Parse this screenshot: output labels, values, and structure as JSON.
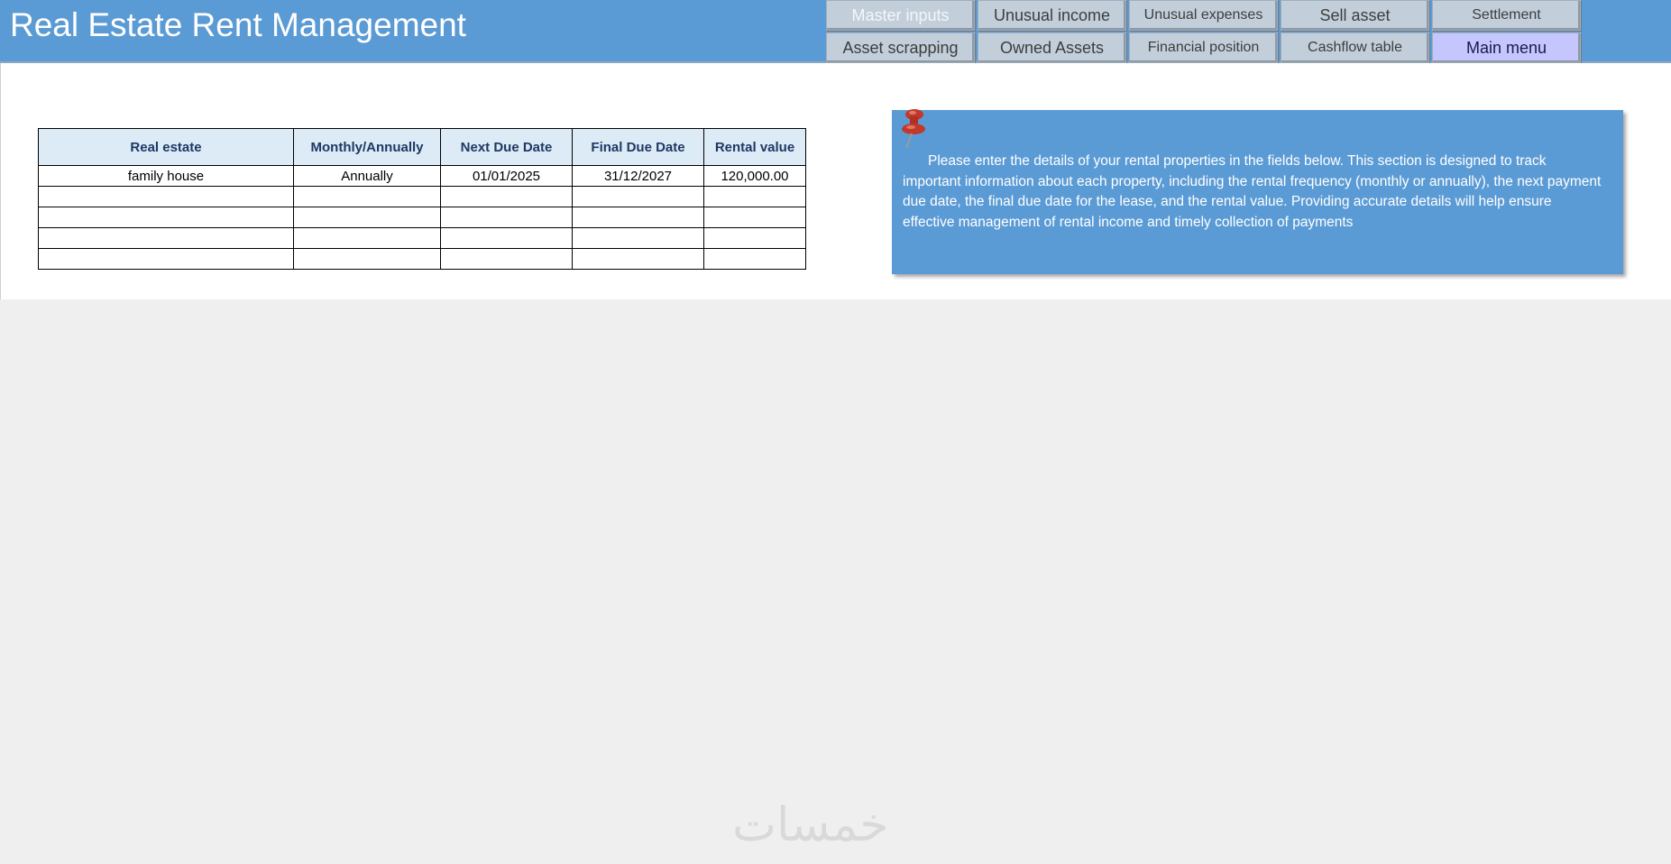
{
  "header": {
    "title": "Real Estate Rent Management"
  },
  "nav": {
    "row1": [
      "Master inputs",
      "Unusual income",
      "Unusual expenses",
      "Sell asset",
      "Settlement"
    ],
    "row2": [
      "Asset scrapping",
      "Owned Assets",
      "Financial position",
      "Cashflow table",
      "Main menu"
    ]
  },
  "table": {
    "headers": [
      "Real estate",
      "Monthly/Annually",
      "Next Due Date",
      "Final Due Date",
      "Rental value"
    ],
    "rows": [
      [
        "family house",
        "Annually",
        "01/01/2025",
        "31/12/2027",
        "120,000.00"
      ],
      [
        "",
        "",
        "",
        "",
        ""
      ],
      [
        "",
        "",
        "",
        "",
        ""
      ],
      [
        "",
        "",
        "",
        "",
        ""
      ],
      [
        "",
        "",
        "",
        "",
        ""
      ]
    ]
  },
  "note": {
    "text": "Please enter the details of your rental properties in the fields below. This section is designed to track important information about each property, including the rental frequency (monthly or annually), the next payment due date, the final due date for the lease, and the rental value. Providing accurate details will help ensure effective management of rental income and timely collection of payments"
  },
  "watermark": "خمسات",
  "colors": {
    "header": "#5b9bd5",
    "table_header": "#ddebf7",
    "active_button": "#c6c6ff"
  }
}
